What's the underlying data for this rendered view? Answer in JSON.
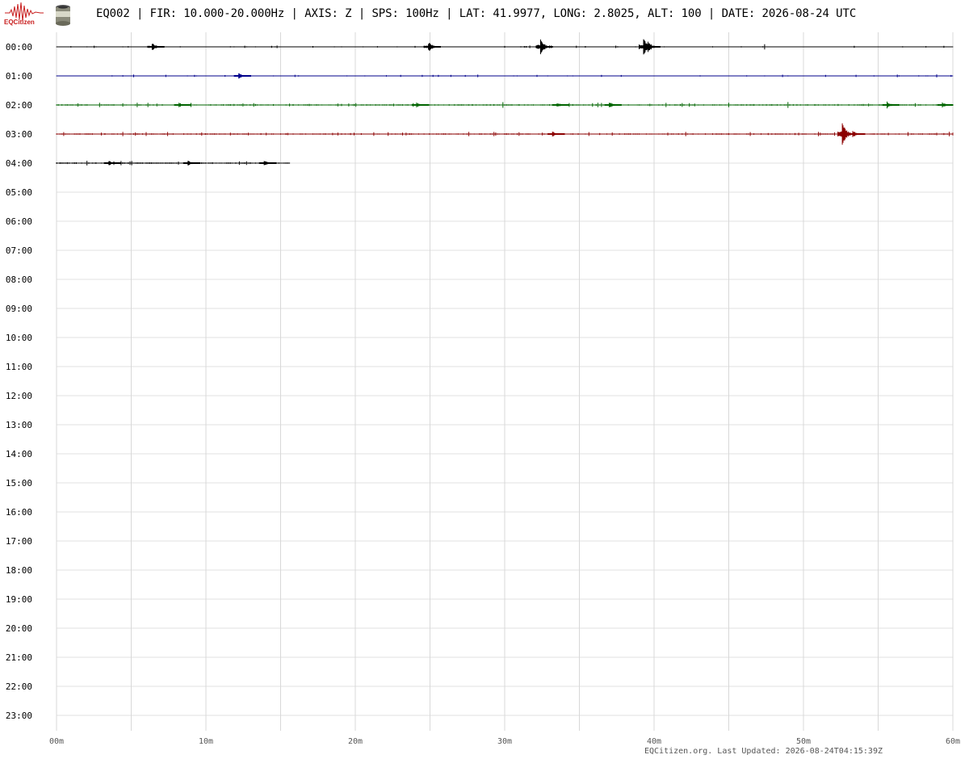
{
  "header": {
    "logo_text": "EQCitizen",
    "title": "EQ002 | FIR: 10.000-20.000Hz | AXIS: Z | SPS: 100Hz | LAT: 41.9977, LONG: 2.8025, ALT: 100 | DATE: 2026-08-24 UTC"
  },
  "footer": {
    "text": "EQCitizen.org. Last Updated: 2026-08-24T04:15:39Z"
  },
  "icons": {
    "logo": "seismograph-logo-icon",
    "sensor": "sensor-canister-icon"
  },
  "chart_data": {
    "type": "helicorder",
    "title": "EQ002 | FIR: 10.000-20.000Hz | AXIS: Z | SPS: 100Hz | LAT: 41.9977, LONG: 2.8025, ALT: 100 | DATE: 2026-08-24 UTC",
    "row_labels": [
      "00:00",
      "01:00",
      "02:00",
      "03:00",
      "04:00",
      "05:00",
      "06:00",
      "07:00",
      "08:00",
      "09:00",
      "10:00",
      "11:00",
      "12:00",
      "13:00",
      "14:00",
      "15:00",
      "16:00",
      "17:00",
      "18:00",
      "19:00",
      "20:00",
      "21:00",
      "22:00",
      "23:00"
    ],
    "x_ticks": [
      "00m",
      "10m",
      "20m",
      "30m",
      "40m",
      "50m",
      "60m"
    ],
    "xlim": [
      0,
      60
    ],
    "grid": true,
    "trace_colors": [
      "#000000",
      "#00008b",
      "#006400",
      "#8b0000"
    ],
    "traces": [
      {
        "hour": "00:00",
        "color": "#000000",
        "end_minute": 60,
        "noise_level": 0.35,
        "events": [
          {
            "minute": 6.4,
            "amplitude": 5
          },
          {
            "minute": 24.9,
            "amplitude": 6
          },
          {
            "minute": 32.4,
            "amplitude": 9
          },
          {
            "minute": 39.3,
            "amplitude": 11
          },
          {
            "minute": 39.6,
            "amplitude": 7
          }
        ]
      },
      {
        "hour": "01:00",
        "color": "#00008b",
        "end_minute": 60,
        "noise_level": 0.35,
        "events": [
          {
            "minute": 12.2,
            "amplitude": 4
          }
        ]
      },
      {
        "hour": "02:00",
        "color": "#006400",
        "end_minute": 60,
        "noise_level": 0.6,
        "events": [
          {
            "minute": 8.2,
            "amplitude": 3
          },
          {
            "minute": 24.1,
            "amplitude": 3
          },
          {
            "minute": 33.5,
            "amplitude": 3
          },
          {
            "minute": 37.0,
            "amplitude": 4
          },
          {
            "minute": 55.6,
            "amplitude": 4
          },
          {
            "minute": 59.3,
            "amplitude": 3
          }
        ]
      },
      {
        "hour": "03:00",
        "color": "#8b0000",
        "end_minute": 60,
        "noise_level": 0.6,
        "events": [
          {
            "minute": 33.2,
            "amplitude": 3
          },
          {
            "minute": 52.6,
            "amplitude": 14
          },
          {
            "minute": 53.3,
            "amplitude": 4
          }
        ]
      },
      {
        "hour": "04:00",
        "color": "#000000",
        "end_minute": 15.6,
        "noise_level": 0.7,
        "events": [
          {
            "minute": 3.5,
            "amplitude": 3
          },
          {
            "minute": 8.8,
            "amplitude": 3
          },
          {
            "minute": 13.9,
            "amplitude": 3
          }
        ]
      }
    ]
  }
}
